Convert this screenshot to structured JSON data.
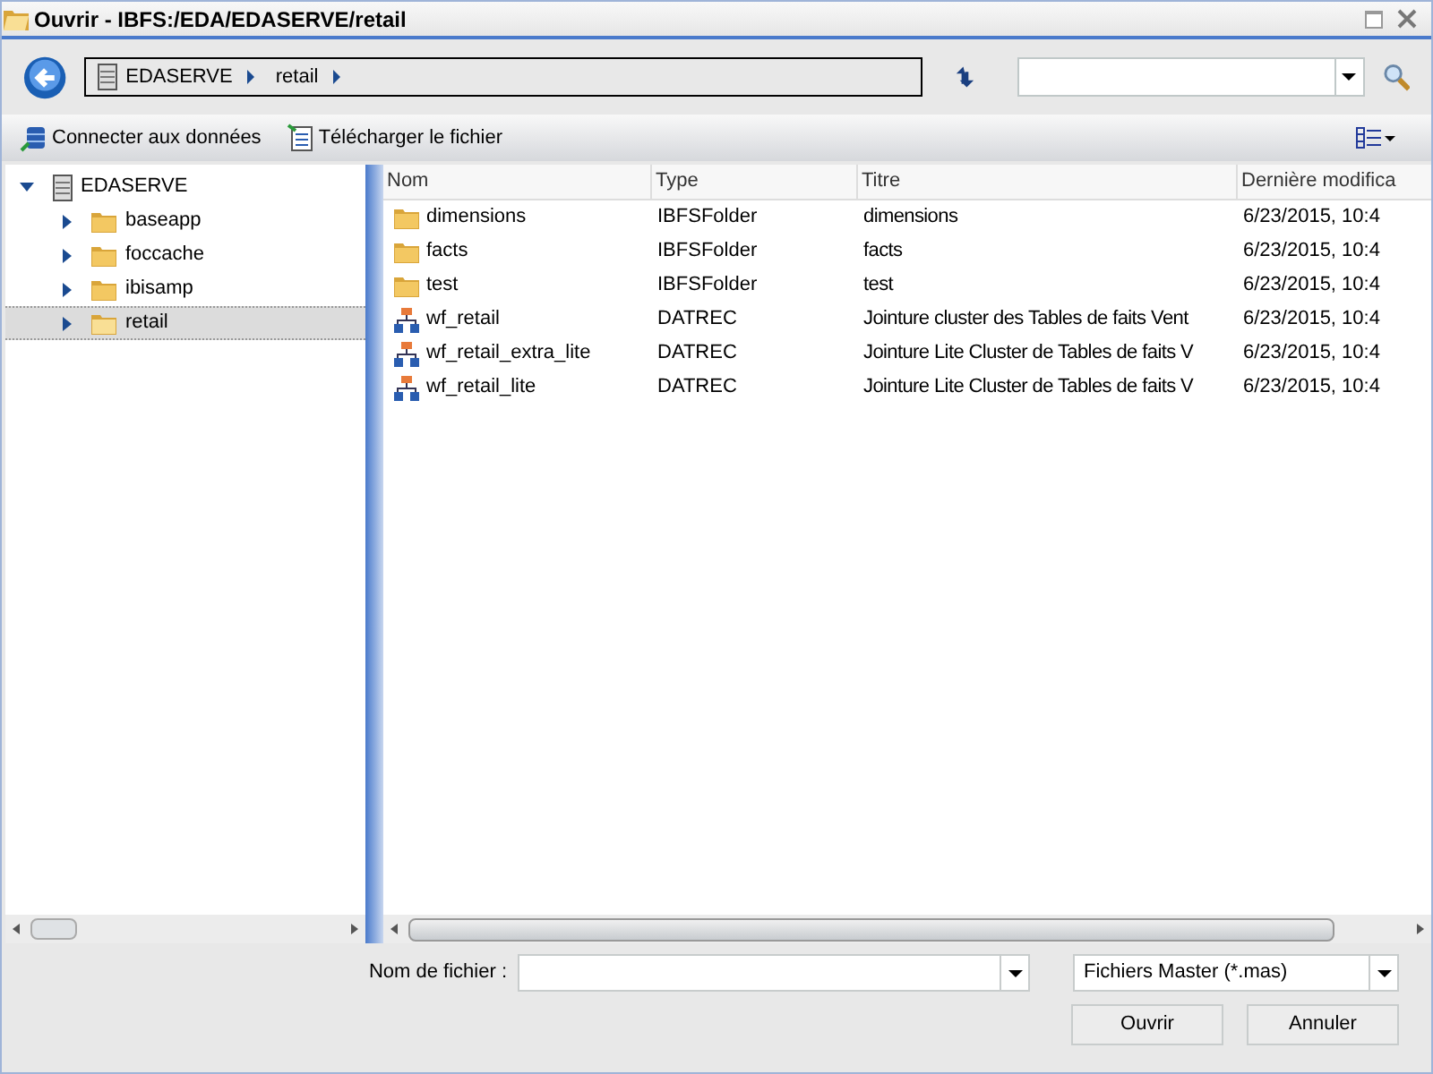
{
  "window": {
    "title": "Ouvrir - IBFS:/EDA/EDASERVE/retail"
  },
  "breadcrumb": [
    {
      "label": "EDASERVE",
      "kind": "server"
    },
    {
      "label": "retail",
      "kind": "folder"
    }
  ],
  "toolbar": [
    {
      "label": "Connecter aux données",
      "kind": "connect"
    },
    {
      "label": "Télécharger le fichier",
      "kind": "upload"
    }
  ],
  "tree": {
    "label": "EDASERVE",
    "kind": "server",
    "expanded": true,
    "selected": false,
    "children": [
      {
        "label": "baseapp",
        "kind": "folder",
        "expanded": false,
        "selected": false
      },
      {
        "label": "foccache",
        "kind": "folder",
        "expanded": false,
        "selected": false
      },
      {
        "label": "ibisamp",
        "kind": "folder",
        "expanded": false,
        "selected": false
      },
      {
        "label": "retail",
        "kind": "folder",
        "expanded": false,
        "selected": true
      }
    ]
  },
  "table": {
    "columns": [
      "Nom",
      "Type",
      "Titre",
      "Dernière modifica"
    ],
    "rows": [
      {
        "kind": "folder",
        "cells": [
          "dimensions",
          "IBFSFolder",
          "dimensions",
          "6/23/2015, 10:4"
        ]
      },
      {
        "kind": "folder",
        "cells": [
          "facts",
          "IBFSFolder",
          "facts",
          "6/23/2015, 10:4"
        ]
      },
      {
        "kind": "folder",
        "cells": [
          "test",
          "IBFSFolder",
          "test",
          "6/23/2015, 10:4"
        ]
      },
      {
        "kind": "datrec",
        "cells": [
          "wf_retail",
          "DATREC",
          "Jointure cluster des Tables de faits Vent",
          "6/23/2015, 10:4"
        ]
      },
      {
        "kind": "datrec",
        "cells": [
          "wf_retail_extra_lite",
          "DATREC",
          "Jointure Lite Cluster de Tables de faits V",
          "6/23/2015, 10:4"
        ]
      },
      {
        "kind": "datrec",
        "cells": [
          "wf_retail_lite",
          "DATREC",
          "Jointure Lite Cluster de Tables de faits V",
          "6/23/2015, 10:4"
        ]
      }
    ]
  },
  "footer": {
    "filename_label": "Nom de fichier :",
    "file_type": "Fichiers Master (*.mas)",
    "buttons": [
      "Ouvrir",
      "Annuler"
    ]
  }
}
